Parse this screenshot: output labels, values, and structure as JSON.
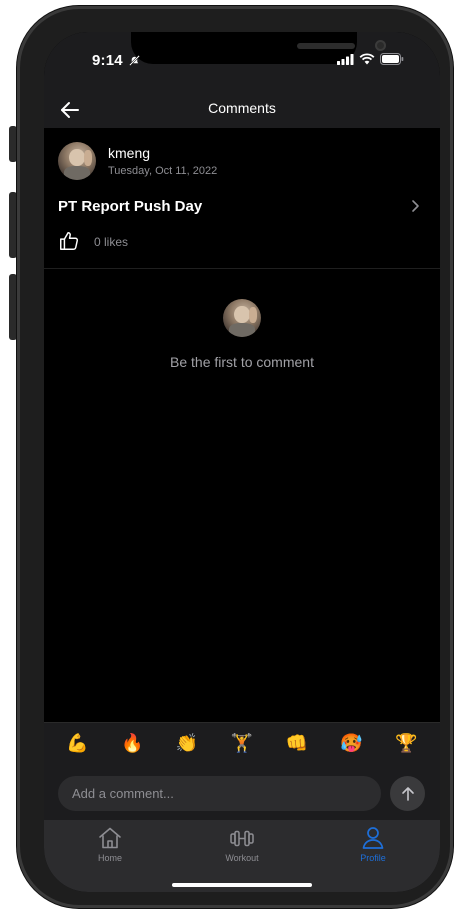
{
  "status_bar": {
    "time": "9:14"
  },
  "header": {
    "title": "Comments"
  },
  "post": {
    "author": "kmeng",
    "date": "Tuesday, Oct 11, 2022",
    "title": "PT Report Push Day",
    "likes": "0 likes"
  },
  "empty_state": {
    "text": "Be the first to comment"
  },
  "reactions": [
    "💪",
    "🔥",
    "👏",
    "🏋️",
    "👊",
    "🥵",
    "🏆"
  ],
  "composer": {
    "placeholder": "Add a comment..."
  },
  "tabs": [
    {
      "label": "Home",
      "icon": "home-icon",
      "active": false
    },
    {
      "label": "Workout",
      "icon": "dumbbell-icon",
      "active": false
    },
    {
      "label": "Profile",
      "icon": "person-icon",
      "active": true
    }
  ],
  "colors": {
    "accent": "#1e6fd9",
    "background": "#000000",
    "surface": "#1c1c1e"
  }
}
